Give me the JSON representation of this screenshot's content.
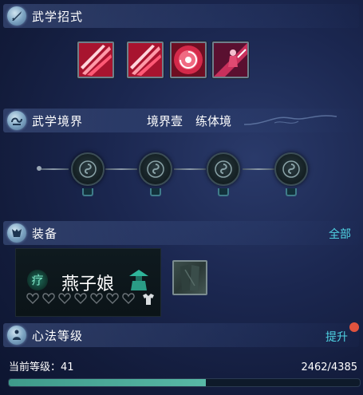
{
  "sections": {
    "moves": {
      "title": "武学招式"
    },
    "realm": {
      "title": "武学境界",
      "stage": "境界壹",
      "stage_name": "练体境"
    },
    "equipment": {
      "title": "装备",
      "all_link": "全部"
    },
    "mind": {
      "title": "心法等级",
      "upgrade_link": "提升"
    }
  },
  "skills": [
    {
      "icon": "slash-skill-icon",
      "color": "#d8264a"
    },
    {
      "icon": "slash-skill-icon",
      "color": "#d8264a"
    },
    {
      "icon": "spiral-rose-skill-icon",
      "color": "#c42445"
    },
    {
      "icon": "swordsman-skill-icon",
      "color": "#b02c5a"
    }
  ],
  "realm_nodes": [
    {
      "icon": "spiral-seal-icon",
      "state": "locked"
    },
    {
      "icon": "spiral-seal-icon",
      "state": "locked"
    },
    {
      "icon": "spiral-seal-icon",
      "state": "locked"
    },
    {
      "icon": "spiral-seal-icon",
      "state": "locked"
    }
  ],
  "equipment": {
    "class_glyph": "疗",
    "character_name": "燕子娘",
    "hearts_total": 7,
    "hearts_filled": 0,
    "accent": "#2fb59a"
  },
  "level": {
    "label": "当前等级：41",
    "exp_text": "2462/4385",
    "exp_fraction": 0.5615,
    "bar_color": "#4fae9c"
  },
  "colors": {
    "link": "#4fd3e3",
    "notify_dot": "#e0533e"
  }
}
